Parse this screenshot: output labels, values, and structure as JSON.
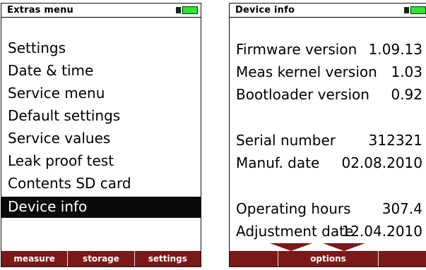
{
  "left_screen": {
    "title": "Extras menu",
    "items": [
      {
        "label": "Settings"
      },
      {
        "label": "Date & time"
      },
      {
        "label": "Service menu"
      },
      {
        "label": "Default settings"
      },
      {
        "label": "Service values"
      },
      {
        "label": "Leak proof test"
      },
      {
        "label": "Contents SD card"
      },
      {
        "label": "Device info",
        "selected": true
      }
    ],
    "softkeys": [
      "measure",
      "storage",
      "settings"
    ]
  },
  "right_screen": {
    "title": "Device info",
    "rows": [
      {
        "key": "Firmware version",
        "value": "1.09.13"
      },
      {
        "key": "Meas kernel version",
        "value": "1.03"
      },
      {
        "key": "Bootloader version",
        "value": "0.92"
      },
      {
        "key": "Serial number",
        "value": "312321"
      },
      {
        "key": "Manuf. date",
        "value": "02.08.2010"
      },
      {
        "key": "Operating hours",
        "value": "307.4"
      },
      {
        "key": "Adjustment date",
        "value": "12.04.2010"
      }
    ],
    "softkeys": [
      "",
      "options",
      ""
    ]
  },
  "colors": {
    "softbar": "#7b1919",
    "battery": "#2ce82c",
    "selection": "#0a0a0a"
  },
  "icons": [
    "battery-icon",
    "scroll-down-arrow-icon"
  ]
}
